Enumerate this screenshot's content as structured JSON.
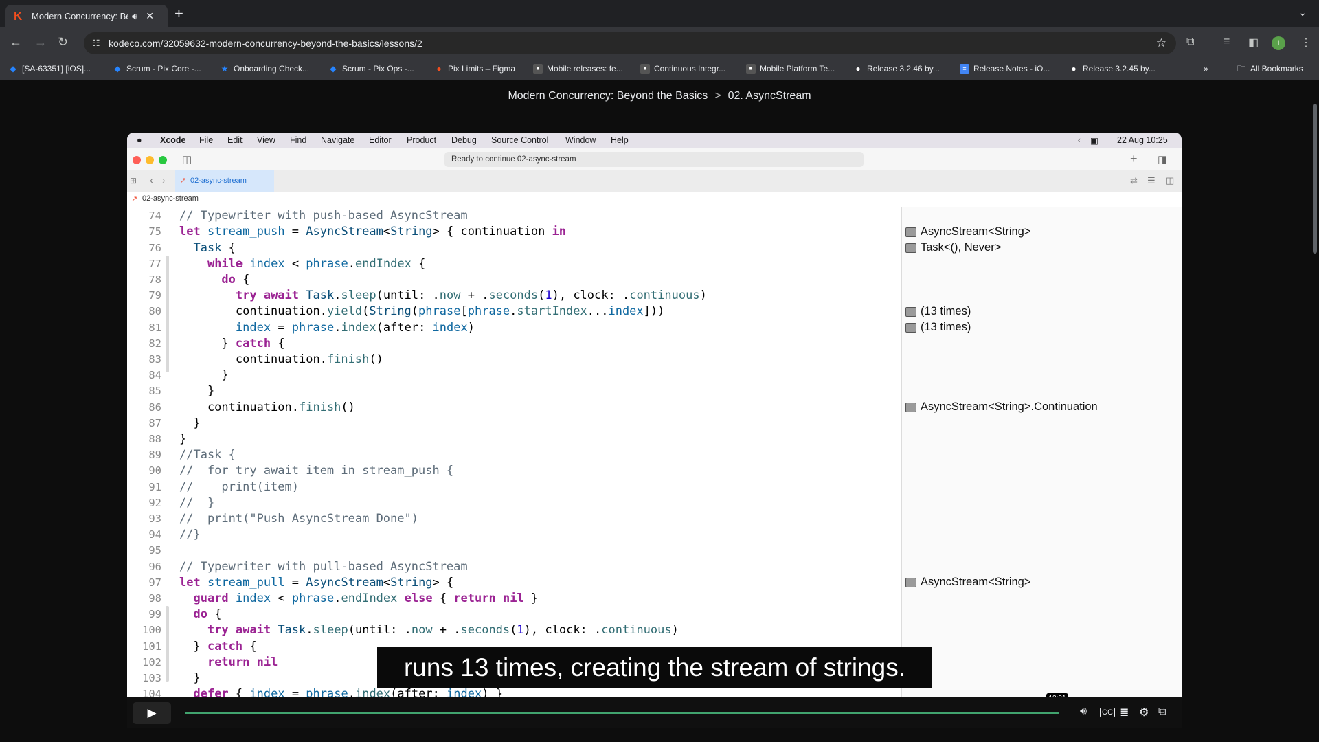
{
  "browser": {
    "tab_title": "Modern Concurrency: Be",
    "url": "kodeco.com/32059632-modern-concurrency-beyond-the-basics/lessons/2",
    "bookmarks": [
      "[SA-63351] [iOS]...",
      "Scrum - Pix Core -...",
      "Onboarding Check...",
      "Scrum - Pix Ops -...",
      "Pix Limits – Figma",
      "Mobile releases: fe...",
      "Continuous Integr...",
      "Mobile Platform Te...",
      "Release 3.2.46 by...",
      "Release Notes - iO...",
      "Release 3.2.45 by..."
    ],
    "all_bookmarks": "All Bookmarks",
    "profile_initial": "I"
  },
  "breadcrumb": {
    "course": "Modern Concurrency: Beyond the Basics",
    "separator": ">",
    "lesson": "02. AsyncStream"
  },
  "mac_menu": [
    "Xcode",
    "File",
    "Edit",
    "View",
    "Find",
    "Navigate",
    "Editor",
    "Product",
    "Debug",
    "Source Control",
    "Window",
    "Help"
  ],
  "mac_clock": "22 Aug  10:25",
  "xcode": {
    "activity": "Ready to continue 02-async-stream",
    "file_tab": "02-async-stream",
    "jump_bar": "02-async-stream",
    "line_numbers": [
      "74",
      "75",
      "76",
      "77",
      "78",
      "79",
      "80",
      "81",
      "82",
      "83",
      "84",
      "85",
      "86",
      "87",
      "88",
      "89",
      "90",
      "91",
      "92",
      "93",
      "94",
      "95",
      "96",
      "97",
      "98",
      "99",
      "100",
      "101",
      "102",
      "103",
      "104"
    ],
    "code_lines": [
      "// Typewriter with push-based AsyncStream",
      "let stream_push = AsyncStream<String> { continuation in",
      "  Task {",
      "    while index < phrase.endIndex {",
      "      do {",
      "        try await Task.sleep(until: .now + .seconds(1), clock: .continuous)",
      "        continuation.yield(String(phrase[phrase.startIndex...index]))",
      "        index = phrase.index(after: index)",
      "      } catch {",
      "        continuation.finish()",
      "      }",
      "    }",
      "    continuation.finish()",
      "  }",
      "}",
      "//Task {",
      "//  for try await item in stream_push {",
      "//    print(item)",
      "//  }",
      "//  print(\"Push AsyncStream Done\")",
      "//}",
      "",
      "// Typewriter with pull-based AsyncStream",
      "let stream_pull = AsyncStream<String> {",
      "  guard index < phrase.endIndex else { return nil }",
      "  do {",
      "    try await Task.sleep(until: .now + .seconds(1), clock: .continuous)",
      "  } catch {",
      "    return nil",
      "  }",
      "  defer { index = phrase.index(after: index) }"
    ],
    "results": {
      "r75": "AsyncStream<String>",
      "r76": "Task<(), Never>",
      "r80": "(13 times)",
      "r81": "(13 times)",
      "r86": "AsyncStream<String>.Continuation",
      "r97": "AsyncStream<String>"
    }
  },
  "video": {
    "caption": "runs 13 times, creating the stream of strings.",
    "time": "12:01",
    "progress": 1.0
  }
}
